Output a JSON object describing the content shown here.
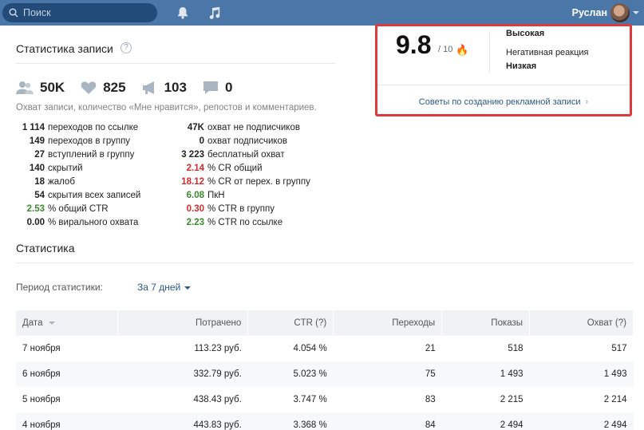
{
  "topbar": {
    "search_placeholder": "Поиск",
    "username": "Руслан",
    "icons": [
      "search-icon",
      "bell-icon",
      "music-icon"
    ],
    "color": "#4a76a8"
  },
  "post_stats": {
    "title": "Статистика записи",
    "help": "?",
    "metrics": {
      "reach": "50K",
      "likes": "825",
      "reposts": "103",
      "comments": "0"
    },
    "caption": "Охват записи, количество «Мне нравится», репостов и комментариев.",
    "left_column": [
      {
        "value": "1 114",
        "label": "переходов по ссылке"
      },
      {
        "value": "149",
        "label": "переходов в группу"
      },
      {
        "value": "27",
        "label": "вступлений в группу"
      },
      {
        "value": "140",
        "label": "скрытий"
      },
      {
        "value": "18",
        "label": "жалоб"
      },
      {
        "value": "54",
        "label": "скрытия всех записей"
      },
      {
        "value": "2.53",
        "label": "% общий CTR",
        "color": "green"
      },
      {
        "value": "0.00",
        "label": "% вирального охвата"
      }
    ],
    "right_column": [
      {
        "value": "47K",
        "label": "охват не подписчиков"
      },
      {
        "value": "0",
        "label": "охват подписчиков"
      },
      {
        "value": "3 223",
        "label": "бесплатный охват"
      },
      {
        "value": "2.14",
        "label": "% CR общий",
        "color": "red"
      },
      {
        "value": "18.12",
        "label": "% CR от перех. в группу",
        "color": "red"
      },
      {
        "value": "6.08",
        "label": "ПкН",
        "color": "green"
      },
      {
        "value": "0.30",
        "label": "% CTR в группу",
        "color": "red"
      },
      {
        "value": "2.23",
        "label": "% CTR по ссылке",
        "color": "green"
      }
    ]
  },
  "stats": {
    "title": "Статистика",
    "period_label": "Период статистики:",
    "period_value": "За 7 дней",
    "columns": [
      "Дата",
      "Потрачено",
      "CTR (?)",
      "Переходы",
      "Показы",
      "Охват (?)"
    ],
    "rows": [
      [
        "7 ноября",
        "113.23 руб.",
        "4.054 %",
        "21",
        "518",
        "517"
      ],
      [
        "6 ноября",
        "332.79 руб.",
        "5.023 %",
        "75",
        "1 493",
        "1 493"
      ],
      [
        "5 ноября",
        "438.43 руб.",
        "3.747 %",
        "83",
        "2 215",
        "2 214"
      ],
      [
        "4 ноября",
        "443.83 руб.",
        "3.368 %",
        "84",
        "2 494",
        "2 494"
      ]
    ]
  },
  "rating_card": {
    "score": "9.8",
    "score_max": "/ 10",
    "fire": "🔥",
    "quality_value": "Высокая",
    "negative_label": "Негативная реакция",
    "negative_value": "Низкая",
    "link": "Советы по созданию рекламной записи",
    "link_chevron": "›",
    "border_color": "#de3a3a"
  }
}
